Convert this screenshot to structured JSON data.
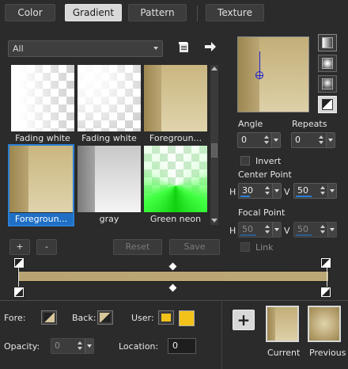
{
  "tabs": [
    {
      "label": "Color",
      "active": false
    },
    {
      "label": "Gradient",
      "active": true
    },
    {
      "label": "Pattern",
      "active": false
    },
    {
      "label": "Texture",
      "active": false
    }
  ],
  "preset_filter": {
    "value": "All"
  },
  "icons": {
    "library": "library-icon",
    "arrow": "arrow-right-icon"
  },
  "thumbnails": [
    {
      "label": "Fading white",
      "kind": "fade-checker"
    },
    {
      "label": "Fading white",
      "kind": "fade-checker"
    },
    {
      "label": "Foregroun...",
      "kind": "fg-bg"
    },
    {
      "label": "Foregroun...",
      "kind": "fg-bg",
      "selected": true
    },
    {
      "label": "gray",
      "kind": "gray"
    },
    {
      "label": "Green neon",
      "kind": "green"
    }
  ],
  "list_buttons": {
    "add": "+",
    "remove": "-",
    "reset": "Reset",
    "save": "Save"
  },
  "angle": {
    "label": "Angle",
    "value": "0"
  },
  "repeats": {
    "label": "Repeats",
    "value": "0"
  },
  "invert": {
    "label": "Invert",
    "checked": false
  },
  "center_point": {
    "title": "Center Point",
    "h_label": "H",
    "h": "30",
    "v_label": "V",
    "v": "50"
  },
  "focal_point": {
    "title": "Focal Point",
    "h_label": "H",
    "h": "50",
    "v_label": "V",
    "v": "50"
  },
  "link": {
    "label": "Link",
    "checked": false
  },
  "bottom": {
    "fore_label": "Fore:",
    "back_label": "Back:",
    "user_label": "User:",
    "opacity_label": "Opacity:",
    "opacity_value": "0",
    "location_label": "Location:",
    "location_value": "0",
    "current_label": "Current",
    "previous_label": "Previous",
    "add_label": "+"
  },
  "colors": {
    "gold": "#b8a472",
    "gold_light": "#d6c79a",
    "gold_dark": "#9c8650",
    "user_yellow": "#f2c21b",
    "accent": "#2a7fd4"
  }
}
